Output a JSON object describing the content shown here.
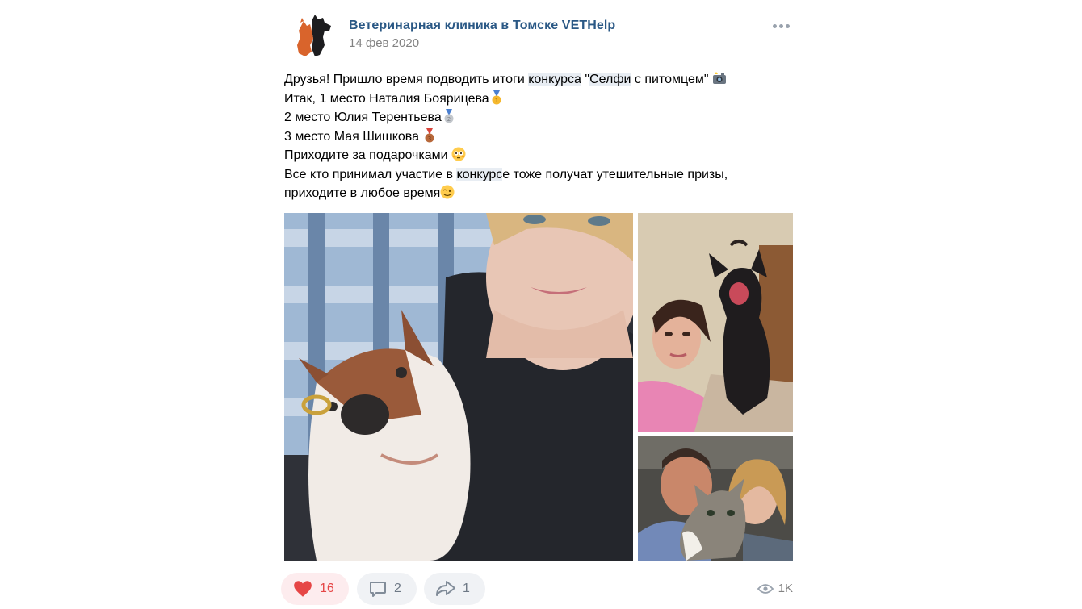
{
  "post": {
    "author": "Ветеринарная клиника в Томске VETHelp",
    "date": "14 фев 2020",
    "text": {
      "l1_a": "Друзья! Пришло время подводить итоги ",
      "l1_hl1": "конкурса",
      "l1_b": " \"",
      "l1_hl2": "Селфи",
      "l1_c": " с питомцем\" ",
      "l2": "Итак, 1 место Наталия Боярицева",
      "l3": "2 место Юлия Терентьева",
      "l4": "3 место Мая Шишкова ",
      "l5": "Приходите за подарочками ",
      "l6_a": "Все кто принимал участие в ",
      "l6_hl": "конкурс",
      "l6_b": "е тоже получат утешительные призы,",
      "l7": "приходите в любое время"
    },
    "emoji": {
      "camera": "camera-flash-emoji",
      "gold": "gold-medal-emoji",
      "silver": "silver-medal-emoji",
      "bronze": "bronze-medal-emoji",
      "flushed": "flushed-face-emoji",
      "wink": "winking-face-emoji"
    }
  },
  "actions": {
    "likes": "16",
    "comments": "2",
    "shares": "1",
    "views": "1K"
  },
  "colors": {
    "link": "#2a5885",
    "like": "#e64646",
    "highlight": "#e8edf3",
    "button_bg": "#f0f2f5"
  }
}
